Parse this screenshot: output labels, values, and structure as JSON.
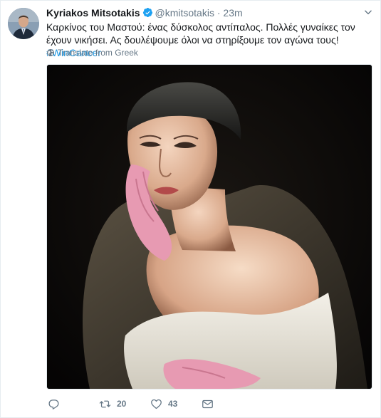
{
  "tweet": {
    "author_name": "Kyriakos Mitsotakis",
    "handle": "@kmitsotakis",
    "separator": "·",
    "time": "23m",
    "text_line1": "Καρκίνος του Μαστού: ένας δύσκολος αντίπαλος. Πολλές γυναίκες τον",
    "text_line2_prefix": "έχουν νικήσει. Ας δουλέψουμε όλοι να στηρίξουμε τον αγώνα τους! ",
    "hashtag": "#WinCancer",
    "translate_label": "Translate from Greek"
  },
  "actions": {
    "reply_count": "",
    "retweet_count": "20",
    "like_count": "43"
  },
  "colors": {
    "link": "#1b95e0",
    "muted": "#657786",
    "text": "#14171a",
    "verified": "#1da1f2",
    "media_bg": "#0b0a09"
  },
  "icons": {
    "verified": "verified-badge-icon",
    "caret": "chevron-down-icon",
    "globe": "globe-icon",
    "reply": "reply-icon",
    "retweet": "retweet-icon",
    "like": "heart-icon",
    "dm": "envelope-icon"
  }
}
